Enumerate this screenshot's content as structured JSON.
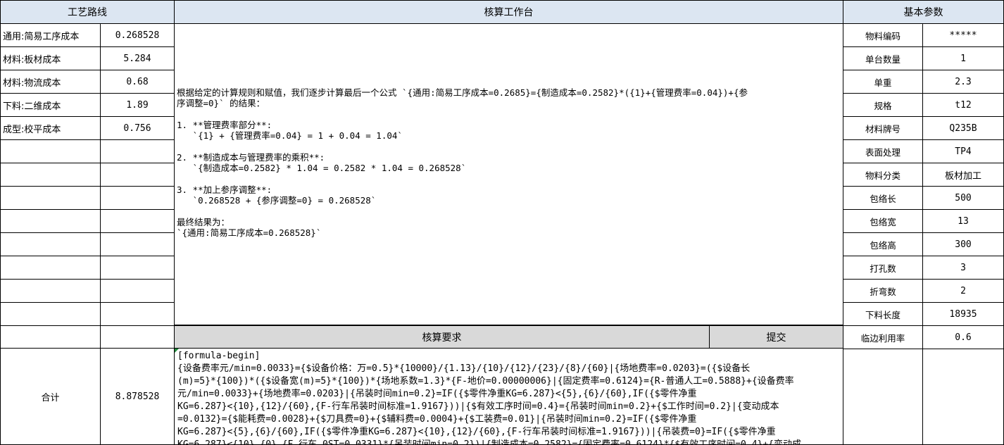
{
  "headers": {
    "route": "工艺路线",
    "workbench": "核算工作台",
    "params": "基本参数"
  },
  "route_items": [
    {
      "label": "通用:简易工序成本",
      "value": "0.268528"
    },
    {
      "label": "材料:板材成本",
      "value": "5.284"
    },
    {
      "label": "材料:物流成本",
      "value": "0.68"
    },
    {
      "label": "下料:二维成本",
      "value": "1.89"
    },
    {
      "label": "成型:校平成本",
      "value": "0.756"
    }
  ],
  "total": {
    "label": "合计",
    "value": "8.878528"
  },
  "params": [
    {
      "label": "物料编码",
      "value": "*****"
    },
    {
      "label": "单台数量",
      "value": "1"
    },
    {
      "label": "单重",
      "value": "2.3"
    },
    {
      "label": "规格",
      "value": "t12"
    },
    {
      "label": "材料牌号",
      "value": "Q235B"
    },
    {
      "label": "表面处理",
      "value": "TP4"
    },
    {
      "label": "物料分类",
      "value": "板材加工"
    },
    {
      "label": "包络长",
      "value": "500"
    },
    {
      "label": "包络宽",
      "value": "13"
    },
    {
      "label": "包络高",
      "value": "300"
    },
    {
      "label": "打孔数",
      "value": "3"
    },
    {
      "label": "折弯数",
      "value": "2"
    },
    {
      "label": "下料长度",
      "value": "18935"
    },
    {
      "label": "临边利用率",
      "value": "0.6"
    }
  ],
  "workbench_text": "根据给定的计算规则和赋值，我们逐步计算最后一个公式 `{通用:简易工序成本=0.2685}={制造成本=0.2582}*({1}+{管理费率=0.04})+{参\n序调整=0}` 的结果：\n\n1. **管理费率部分**:\n   `{1} + {管理费率=0.04} = 1 + 0.04 = 1.04`\n\n2. **制造成本与管理费率的乘积**:\n   `{制造成本=0.2582} * 1.04 = 0.2582 * 1.04 = 0.268528`\n\n3. **加上参序调整**:\n   `0.268528 + {参序调整=0} = 0.268528`\n\n最终结果为：\n`{通用:简易工序成本=0.268528}`",
  "calc_requirement_label": "核算要求",
  "submit_label": "提交",
  "formula_text": "[formula-begin]\n{设备费率元/min=0.0033}={$设备价格：万=0.5}*{10000}/{1.13}/{10}/{12}/{23}/{8}/{60}|{场地费率=0.0203}=({$设备长\n(m)=5}*{100})*({$设备宽(m)=5}*{100})*{场地系数=1.3}*{F-地价=0.00000006}|{固定费率=0.6124}={R-普通人工=0.5888}+{设备费率\n元/min=0.0033}+{场地费率=0.0203}|{吊装时间min=0.2}=IF({$零件净重KG=6.287}<{5},{6}/{60},IF({$零件净重\nKG=6.287}<{10},{12}/{60},{F-行车吊装时间标准=1.9167}))|{$有效工序时间=0.4}={吊装时间min=0.2}+{$工作时间=0.2}|{变动成本\n=0.0132}={$能耗费=0.0028}+{$刀具费=0}+{$辅料费=0.0004}+{$工装费=0.01}|{吊装时间min=0.2}=IF({$零件净重\nKG=6.287}<{5},{6}/{60},IF({$零件净重KG=6.287}<{10},{12}/{60},{F-行车吊装时间标准=1.9167}))|{吊装费=0}=IF({$零件净重\nKG=6.287}<{10},{0},{F-行车_0ST=0.0331}*{吊装时间min=0.2})|{制造成本=0.2582}={固定费率=0.6124}*{$有效工序时间=0.4}+{变动成"
}
